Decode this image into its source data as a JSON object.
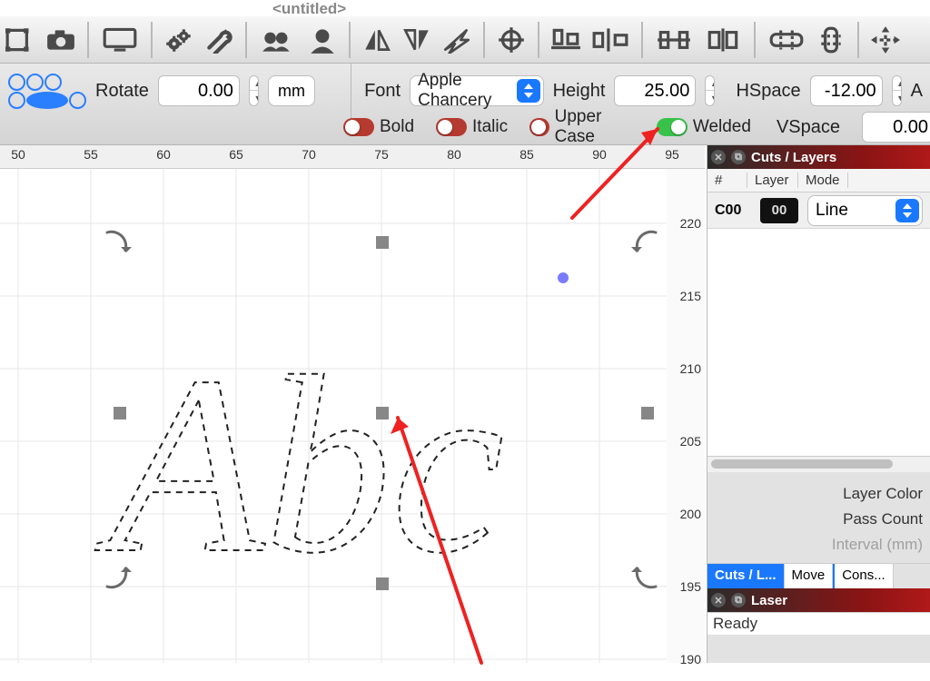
{
  "title": "<untitled>",
  "rotate": {
    "label": "Rotate",
    "value": "0.00",
    "units": "mm"
  },
  "font": {
    "label": "Font",
    "name": "Apple Chancery",
    "height_label": "Height",
    "height": "25.00",
    "hspace_label": "HSpace",
    "hspace": "-12.00",
    "vspace_label": "VSpace",
    "vspace": "0.00",
    "align_label": "A",
    "bold": "Bold",
    "italic": "Italic",
    "upper": "Upper Case",
    "welded": "Welded"
  },
  "canvas": {
    "hticks": [
      50,
      55,
      60,
      65,
      70,
      75,
      80,
      85,
      90,
      95
    ],
    "vticks": [
      220,
      215,
      210,
      205,
      200,
      195,
      190
    ],
    "text": "Abc"
  },
  "cuts_panel": {
    "title": "Cuts / Layers",
    "cols": {
      "num": "#",
      "layer": "Layer",
      "mode": "Mode"
    },
    "row": {
      "id": "C00",
      "badge": "00",
      "mode": "Line"
    },
    "props": {
      "layer_color": "Layer Color",
      "pass_count": "Pass Count",
      "interval": "Interval (mm)"
    },
    "tabs": {
      "cuts": "Cuts / L...",
      "move": "Move",
      "cons": "Cons..."
    }
  },
  "laser_panel": {
    "title": "Laser",
    "status": "Ready"
  }
}
